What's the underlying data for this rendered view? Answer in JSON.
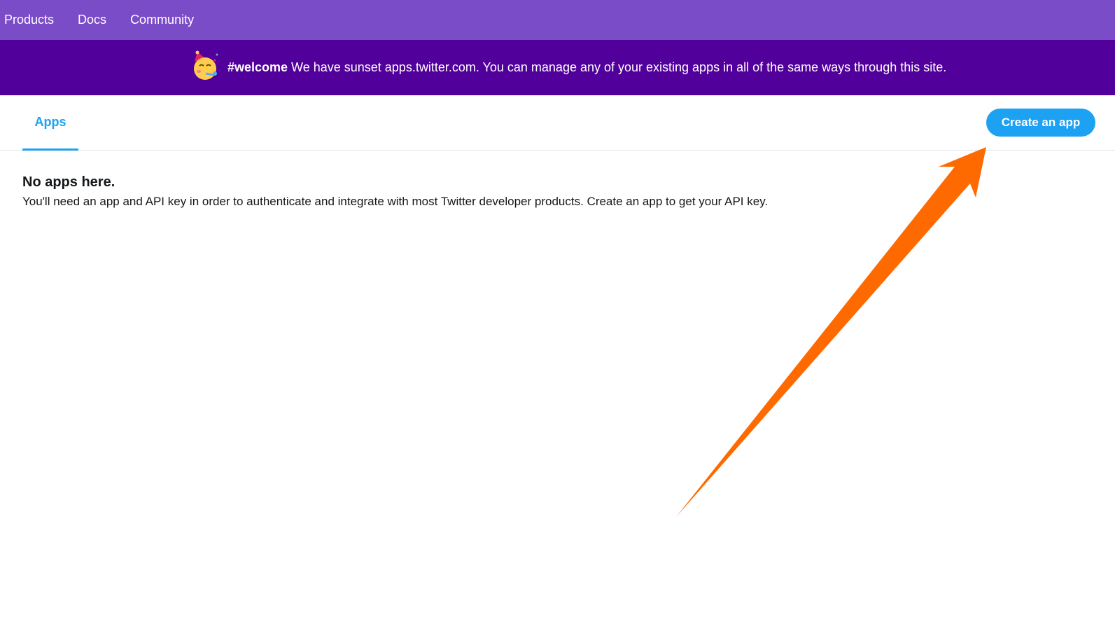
{
  "topnav": {
    "items": [
      "Products",
      "Docs",
      "Community"
    ]
  },
  "banner": {
    "hashtag": "#welcome",
    "message": "We have sunset apps.twitter.com. You can manage any of your existing apps in all of the same ways through this site.",
    "icon": "party-face-icon"
  },
  "tabs": {
    "apps_label": "Apps"
  },
  "actions": {
    "create_app_label": "Create an app"
  },
  "empty_state": {
    "title": "No apps here.",
    "description": "You'll need an app and API key in order to authenticate and integrate with most Twitter developer products. Create an app to get your API key."
  },
  "colors": {
    "nav_bg": "#7b4cc7",
    "banner_bg": "#51009b",
    "accent": "#1da1f2",
    "annotation_arrow": "#ff6a00"
  }
}
